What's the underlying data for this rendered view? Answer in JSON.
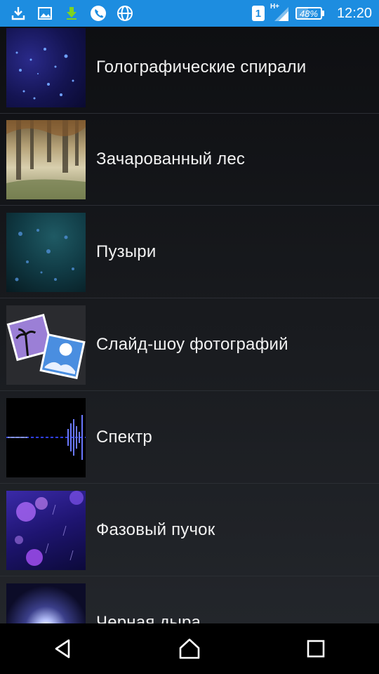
{
  "status_bar": {
    "sim_label": "1",
    "network_label": "H+",
    "battery_level": "48%",
    "battery_fraction": 0.48,
    "time": "12:20",
    "icons": [
      "download-icon",
      "image-icon",
      "download-green-icon",
      "phone-icon",
      "globe-icon"
    ]
  },
  "list": {
    "items": [
      {
        "label": "Голографические спирали",
        "thumb": "holo"
      },
      {
        "label": "Зачарованный лес",
        "thumb": "forest"
      },
      {
        "label": "Пузыри",
        "thumb": "bubbles"
      },
      {
        "label": "Слайд-шоу фотографий",
        "thumb": "slides"
      },
      {
        "label": "Спектр",
        "thumb": "spectrum"
      },
      {
        "label": "Фазовый пучок",
        "thumb": "phase"
      },
      {
        "label": "Черная дыра",
        "thumb": "blackhole"
      }
    ]
  },
  "nav_bar": {
    "icons": [
      "back-icon",
      "home-icon",
      "recents-icon"
    ]
  },
  "colors": {
    "status_bar": "#1d8de0",
    "nav_bar": "#000000",
    "list_text": "#f2f2f2"
  }
}
